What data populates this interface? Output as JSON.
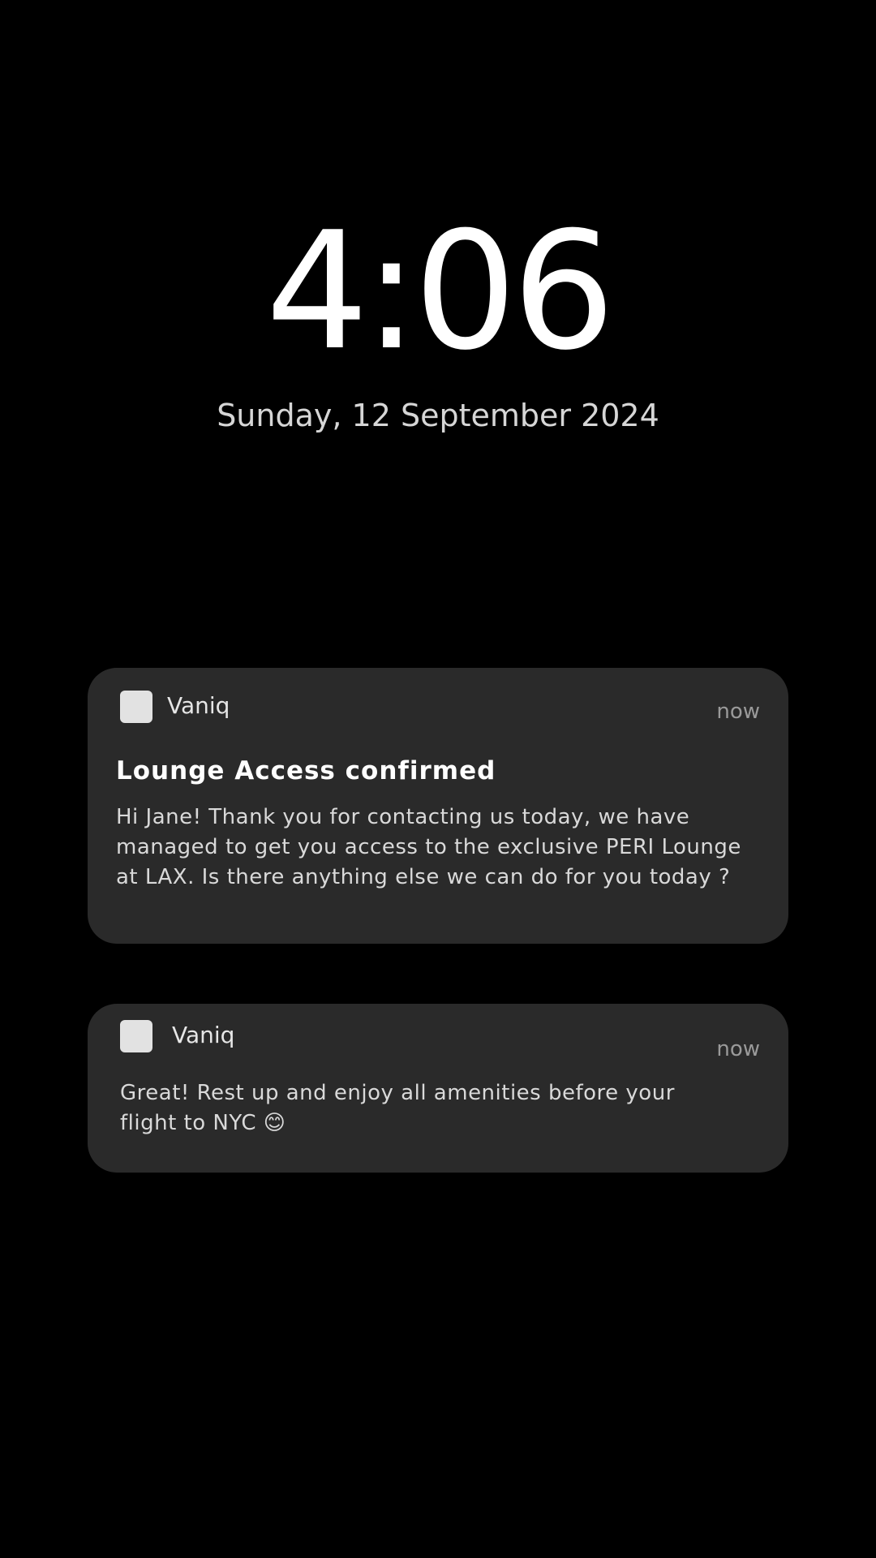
{
  "lockscreen": {
    "time": "4:06",
    "date": "Sunday, 12 September 2024"
  },
  "notifications": [
    {
      "app_name": "Vaniq",
      "app_icon": "app-icon-placeholder",
      "timestamp": "now",
      "title": "Lounge Access confirmed",
      "body": "Hi Jane! Thank you for contacting us today, we have managed to get you access to the exclusive PERI Lounge at LAX. Is there anything else we can do for you today ?"
    },
    {
      "app_name": "Vaniq",
      "app_icon": "app-icon-placeholder",
      "timestamp": "now",
      "title": "",
      "body": "Great! Rest up and enjoy all amenities before your flight to NYC 😊"
    }
  ]
}
